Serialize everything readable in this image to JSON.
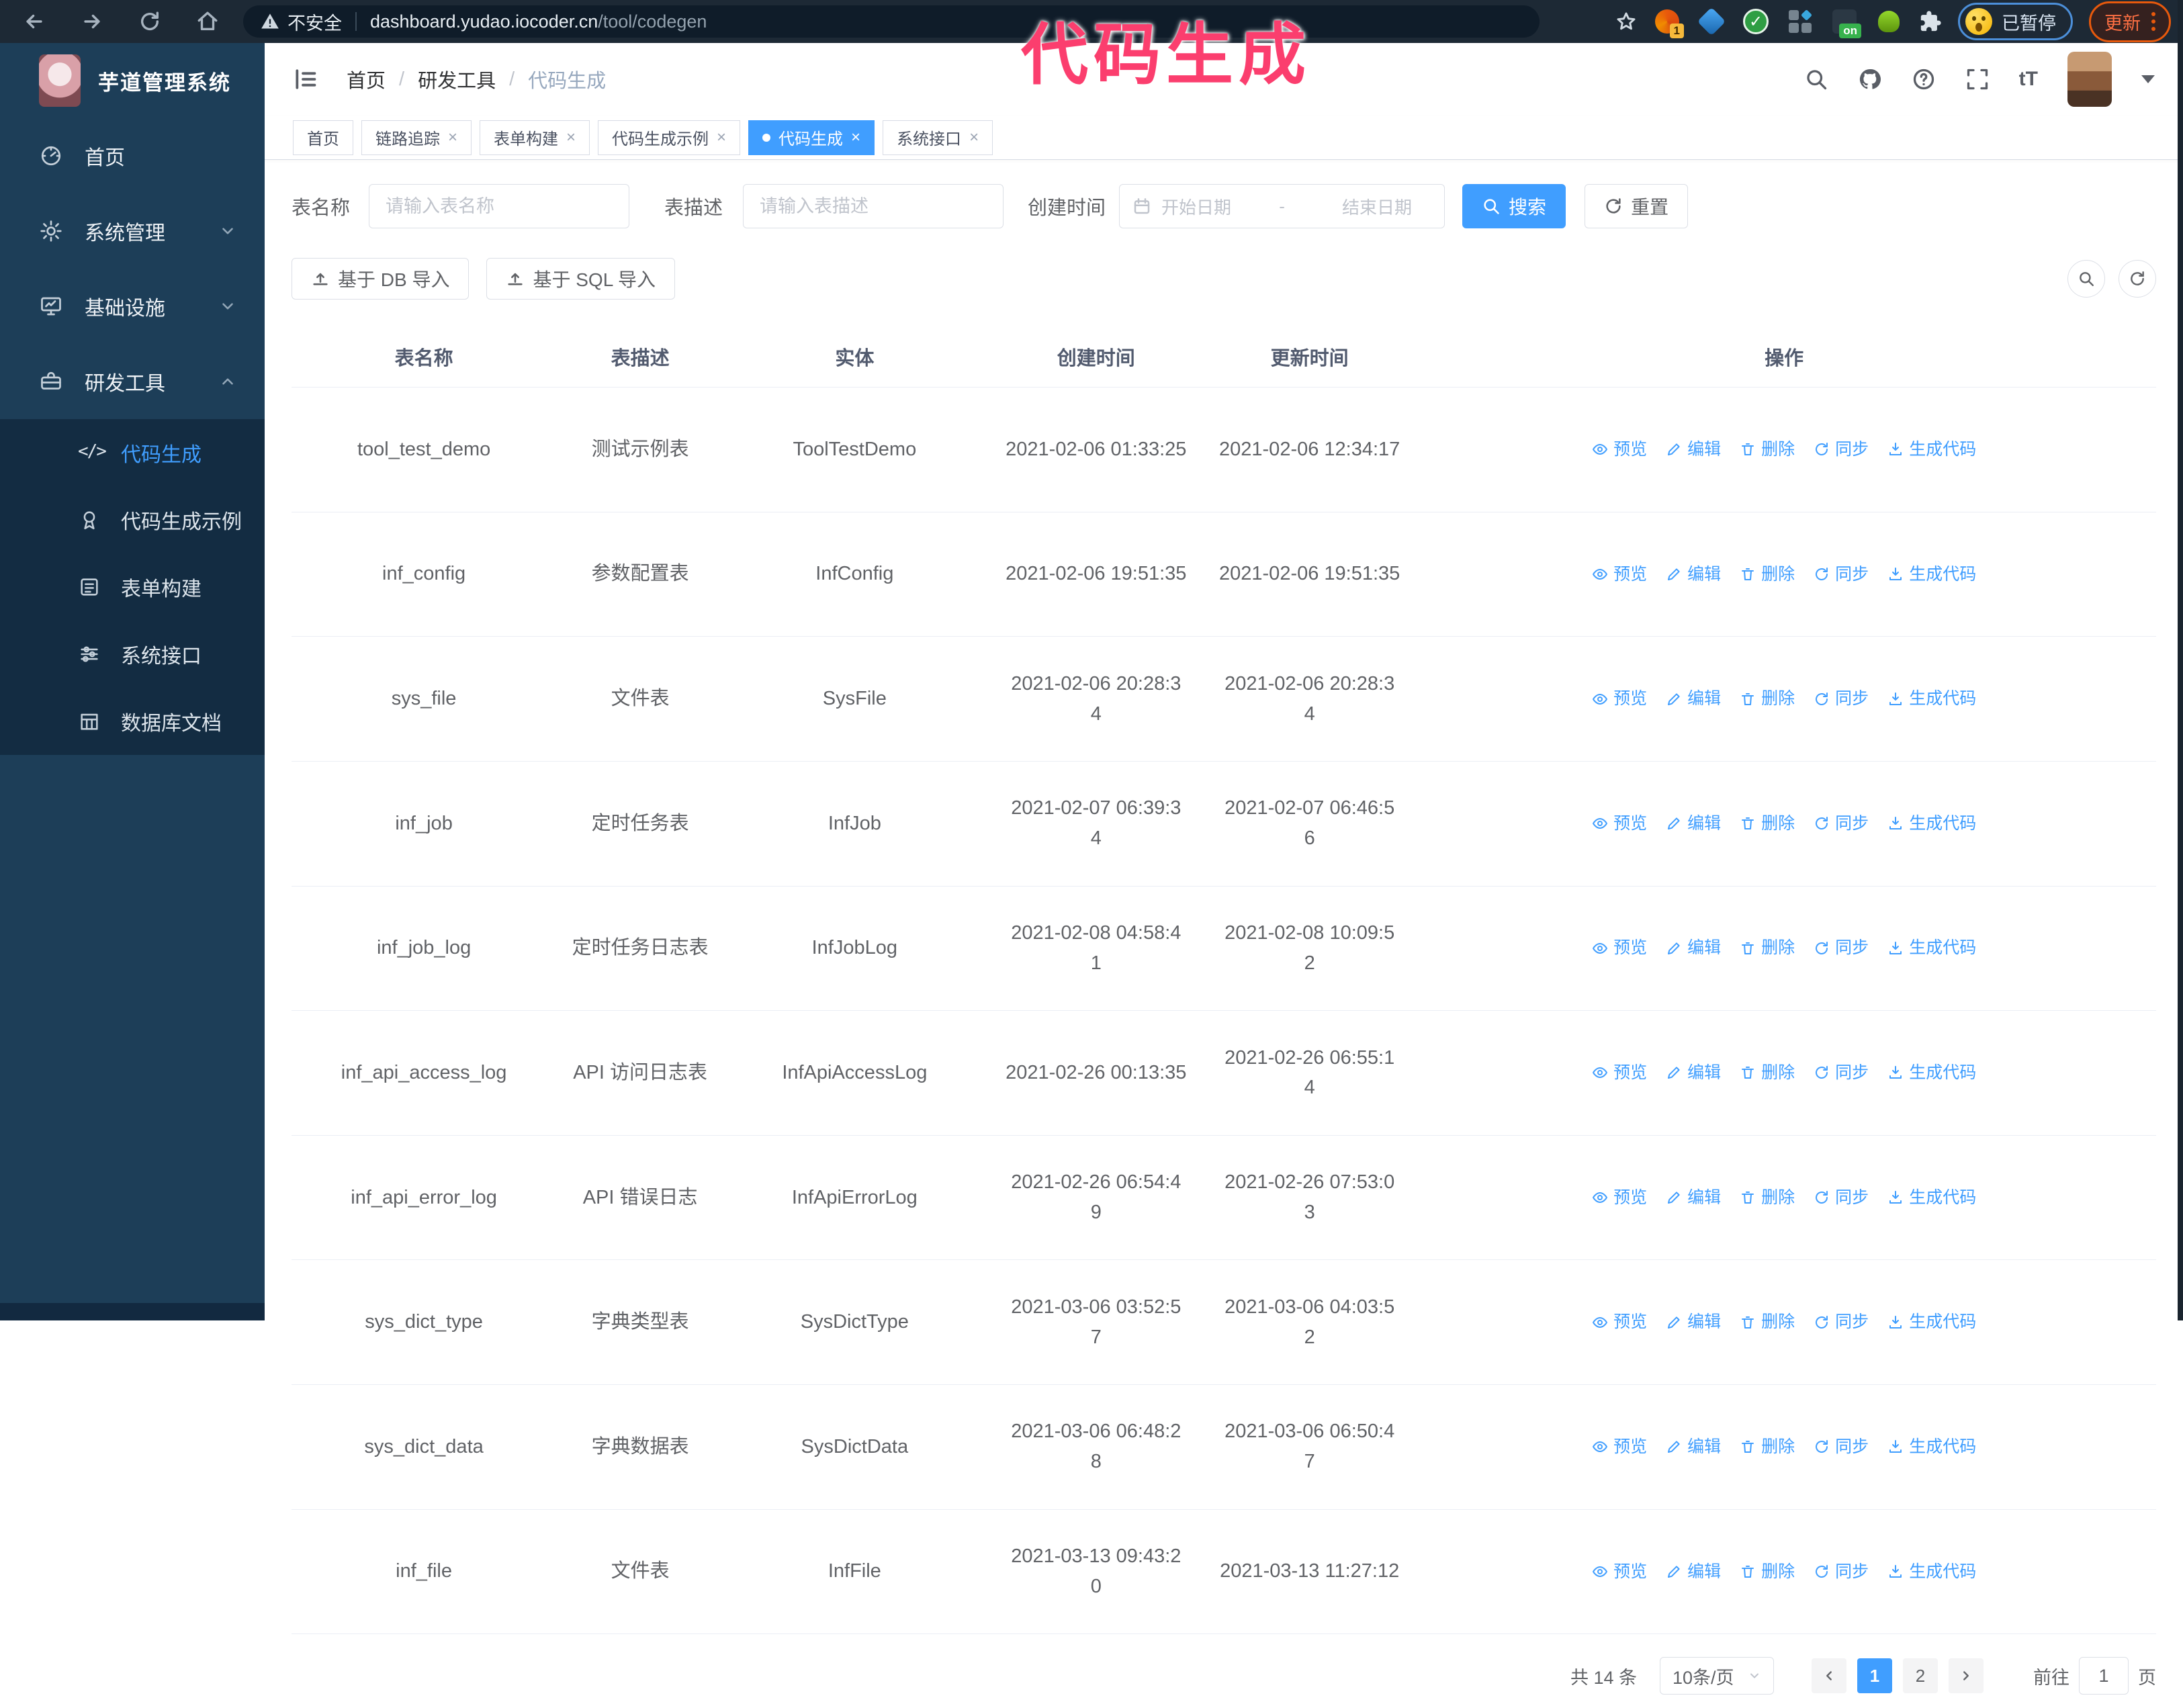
{
  "browser": {
    "security_warning": "不安全",
    "url_host": "dashboard.yudao.iocoder.cn",
    "url_path": "/tool/codegen",
    "extension_badge_1": "1",
    "extension_badge_on": "on",
    "profile_status": "已暂停",
    "update_label": "更新"
  },
  "annotation": {
    "text": "代码生成",
    "color": "#fb3e6e"
  },
  "sidebar": {
    "title": "芋道管理系统",
    "items": [
      {
        "label": "首页",
        "icon": "dashboard-icon"
      },
      {
        "label": "系统管理",
        "icon": "gear-icon"
      },
      {
        "label": "基础设施",
        "icon": "monitor-icon"
      },
      {
        "label": "研发工具",
        "icon": "toolbox-icon"
      }
    ],
    "subitems": [
      {
        "label": "代码生成",
        "icon": "code-icon",
        "active": true
      },
      {
        "label": "代码生成示例",
        "icon": "badge-icon"
      },
      {
        "label": "表单构建",
        "icon": "form-icon"
      },
      {
        "label": "系统接口",
        "icon": "sliders-icon"
      },
      {
        "label": "数据库文档",
        "icon": "table-grid-icon"
      }
    ]
  },
  "header": {
    "breadcrumb": [
      "首页",
      "研发工具",
      "代码生成"
    ],
    "separator": "/"
  },
  "tabs": [
    {
      "label": "首页",
      "closable": false
    },
    {
      "label": "链路追踪",
      "closable": true
    },
    {
      "label": "表单构建",
      "closable": true
    },
    {
      "label": "代码生成示例",
      "closable": true
    },
    {
      "label": "代码生成",
      "closable": true,
      "active": true
    },
    {
      "label": "系统接口",
      "closable": true
    }
  ],
  "icons": {
    "close": "×"
  },
  "filters": {
    "table_name_label": "表名称",
    "table_name_placeholder": "请输入表名称",
    "table_desc_label": "表描述",
    "table_desc_placeholder": "请输入表描述",
    "create_time_label": "创建时间",
    "date_start_placeholder": "开始日期",
    "date_separator": "-",
    "date_end_placeholder": "结束日期",
    "search_label": "搜索",
    "reset_label": "重置",
    "import_db_label": "基于 DB 导入",
    "import_sql_label": "基于 SQL 导入"
  },
  "table": {
    "columns": [
      "表名称",
      "表描述",
      "实体",
      "创建时间",
      "更新时间",
      "操作"
    ],
    "actions": [
      {
        "label": "预览",
        "icon": "eye-icon"
      },
      {
        "label": "编辑",
        "icon": "edit-icon"
      },
      {
        "label": "删除",
        "icon": "trash-icon"
      },
      {
        "label": "同步",
        "icon": "sync-icon"
      },
      {
        "label": "生成代码",
        "icon": "download-icon"
      }
    ],
    "rows": [
      {
        "name": "tool_test_demo",
        "desc": "测试示例表",
        "entity": "ToolTestDemo",
        "created": "2021-02-06 01:33:25",
        "updated": "2021-02-06 12:34:17"
      },
      {
        "name": "inf_config",
        "desc": "参数配置表",
        "entity": "InfConfig",
        "created": "2021-02-06 19:51:35",
        "updated": "2021-02-06 19:51:35"
      },
      {
        "name": "sys_file",
        "desc": "文件表",
        "entity": "SysFile",
        "created": "2021-02-06 20:28:3\n4",
        "updated": "2021-02-06 20:28:3\n4"
      },
      {
        "name": "inf_job",
        "desc": "定时任务表",
        "entity": "InfJob",
        "created": "2021-02-07 06:39:3\n4",
        "updated": "2021-02-07 06:46:5\n6"
      },
      {
        "name": "inf_job_log",
        "desc": "定时任务日志表",
        "entity": "InfJobLog",
        "created": "2021-02-08 04:58:4\n1",
        "updated": "2021-02-08 10:09:5\n2"
      },
      {
        "name": "inf_api_access_log",
        "desc": "API 访问日志表",
        "entity": "InfApiAccessLog",
        "created": "2021-02-26 00:13:35",
        "updated": "2021-02-26 06:55:1\n4"
      },
      {
        "name": "inf_api_error_log",
        "desc": "API 错误日志",
        "entity": "InfApiErrorLog",
        "created": "2021-02-26 06:54:4\n9",
        "updated": "2021-02-26 07:53:0\n3"
      },
      {
        "name": "sys_dict_type",
        "desc": "字典类型表",
        "entity": "SysDictType",
        "created": "2021-03-06 03:52:5\n7",
        "updated": "2021-03-06 04:03:5\n2"
      },
      {
        "name": "sys_dict_data",
        "desc": "字典数据表",
        "entity": "SysDictData",
        "created": "2021-03-06 06:48:2\n8",
        "updated": "2021-03-06 06:50:4\n7"
      },
      {
        "name": "inf_file",
        "desc": "文件表",
        "entity": "InfFile",
        "created": "2021-03-13 09:43:2\n0",
        "updated": "2021-03-13 11:27:12"
      }
    ]
  },
  "pagination": {
    "total": "共 14 条",
    "page_size": "10条/页",
    "page_1": "1",
    "page_2": "2",
    "goto_label": "前往",
    "goto_value": "1",
    "page_unit": "页"
  },
  "colors": {
    "primary": "#409eff",
    "sidebar_bg": "#1d3e58",
    "submenu_bg": "#132c42",
    "chrome_bg": "#1d2935"
  }
}
